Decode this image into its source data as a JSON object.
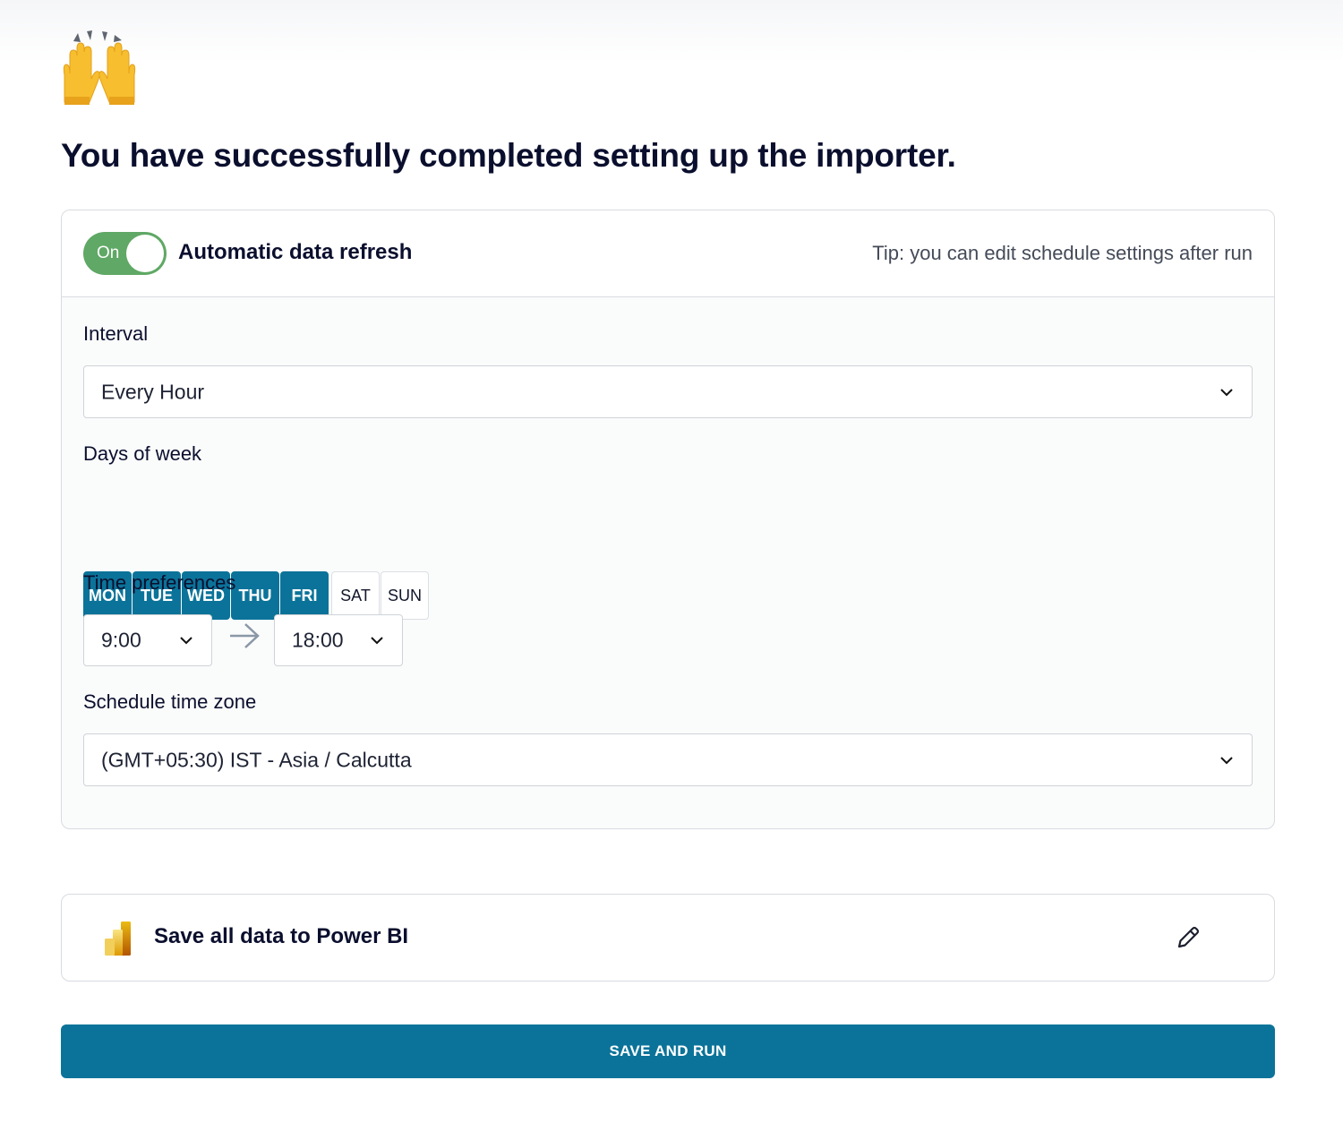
{
  "page": {
    "emoji_icon": "raising-hands-icon",
    "title": "You have successfully completed setting up the importer."
  },
  "refresh": {
    "toggle_state": "On",
    "toggle_color": "#5fa865",
    "title": "Automatic data refresh",
    "tip": "Tip: you can edit schedule settings after run"
  },
  "interval": {
    "label": "Interval",
    "value": "Every Hour"
  },
  "days": {
    "label": "Days of week",
    "active_color": "#0b7399",
    "items": [
      {
        "label": "MON",
        "selected": true
      },
      {
        "label": "TUE",
        "selected": true
      },
      {
        "label": "WED",
        "selected": true
      },
      {
        "label": "THU",
        "selected": true
      },
      {
        "label": "FRI",
        "selected": true
      },
      {
        "label": "SAT",
        "selected": false
      },
      {
        "label": "SUN",
        "selected": false
      }
    ]
  },
  "time": {
    "label": "Time preferences",
    "start": "9:00",
    "end": "18:00"
  },
  "timezone": {
    "label": "Schedule time zone",
    "value": "(GMT+05:30) IST - Asia / Calcutta"
  },
  "destination": {
    "icon": "power-bi-icon",
    "title": "Save all data to Power BI",
    "edit_icon": "pencil-icon"
  },
  "actions": {
    "save_run": "SAVE AND RUN",
    "button_color": "#0b7399"
  }
}
